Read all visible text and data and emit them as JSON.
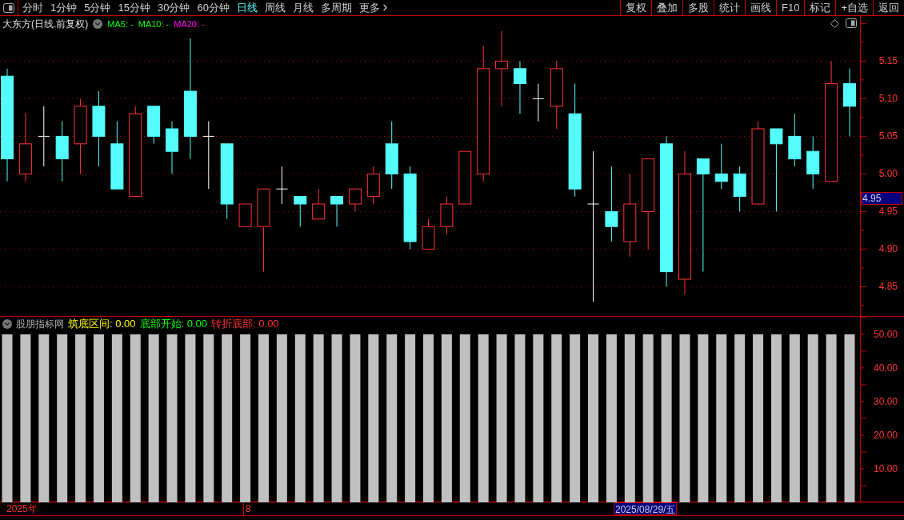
{
  "toolbar": {
    "periods": [
      {
        "label": "分时",
        "selected": false
      },
      {
        "label": "1分钟",
        "selected": false
      },
      {
        "label": "5分钟",
        "selected": false
      },
      {
        "label": "15分钟",
        "selected": false
      },
      {
        "label": "30分钟",
        "selected": false
      },
      {
        "label": "60分钟",
        "selected": false
      },
      {
        "label": "日线",
        "selected": true
      },
      {
        "label": "周线",
        "selected": false
      },
      {
        "label": "月线",
        "selected": false
      },
      {
        "label": "多周期",
        "selected": false
      }
    ],
    "more": "更多",
    "actions": [
      "复权",
      "叠加",
      "多股",
      "统计",
      "画线",
      "F10",
      "标记",
      "+自选",
      "返回"
    ]
  },
  "stock": {
    "title": "大东方(日线.前复权)",
    "indicators": [
      {
        "label": "MA5: -",
        "color": "#00ff00"
      },
      {
        "label": "MA10: -",
        "color": "#00ff00"
      },
      {
        "label": "MA20: -",
        "color": "#ff00ff"
      }
    ]
  },
  "price_chart": {
    "price_marker": "4.95",
    "chart_data": {
      "type": "candlestick",
      "ylim": [
        4.81,
        5.21
      ],
      "yticks": [
        {
          "value": 5.15,
          "label": "5.15"
        },
        {
          "value": 5.1,
          "label": "5.10"
        },
        {
          "value": 5.05,
          "label": "5.05"
        },
        {
          "value": 5.0,
          "label": "5.00"
        },
        {
          "value": 4.95,
          "label": "4.95"
        },
        {
          "value": 4.9,
          "label": "4.90"
        },
        {
          "value": 4.85,
          "label": "4.85"
        }
      ],
      "grid": true,
      "ohlc": [
        [
          5.13,
          5.14,
          4.99,
          5.02
        ],
        [
          5.0,
          5.08,
          4.99,
          5.04
        ],
        [
          5.05,
          5.09,
          5.01,
          5.05
        ],
        [
          5.05,
          5.07,
          4.99,
          5.02
        ],
        [
          5.04,
          5.1,
          5.0,
          5.09
        ],
        [
          5.09,
          5.11,
          5.01,
          5.05
        ],
        [
          5.04,
          5.07,
          4.98,
          4.98
        ],
        [
          4.97,
          5.09,
          4.97,
          5.08
        ],
        [
          5.09,
          5.09,
          5.04,
          5.05
        ],
        [
          5.06,
          5.07,
          5.0,
          5.03
        ],
        [
          5.11,
          5.18,
          5.02,
          5.05
        ],
        [
          5.05,
          5.07,
          4.98,
          5.05
        ],
        [
          5.04,
          5.04,
          4.94,
          4.96
        ],
        [
          4.93,
          4.96,
          4.93,
          4.96
        ],
        [
          4.93,
          4.98,
          4.87,
          4.98
        ],
        [
          4.98,
          5.01,
          4.96,
          4.98
        ],
        [
          4.97,
          4.97,
          4.93,
          4.96
        ],
        [
          4.94,
          4.98,
          4.94,
          4.96
        ],
        [
          4.97,
          4.97,
          4.93,
          4.96
        ],
        [
          4.96,
          4.98,
          4.95,
          4.98
        ],
        [
          4.97,
          5.01,
          4.96,
          5.0
        ],
        [
          5.04,
          5.07,
          4.98,
          5.0
        ],
        [
          5.0,
          5.01,
          4.9,
          4.91
        ],
        [
          4.9,
          4.94,
          4.9,
          4.93
        ],
        [
          4.93,
          4.97,
          4.92,
          4.96
        ],
        [
          4.96,
          5.03,
          4.96,
          5.03
        ],
        [
          5.0,
          5.17,
          4.99,
          5.14
        ],
        [
          5.14,
          5.19,
          5.09,
          5.15
        ],
        [
          5.14,
          5.15,
          5.08,
          5.12
        ],
        [
          5.1,
          5.12,
          5.07,
          5.1
        ],
        [
          5.09,
          5.15,
          5.06,
          5.14
        ],
        [
          5.08,
          5.12,
          4.97,
          4.98
        ],
        [
          4.96,
          5.03,
          4.83,
          4.96
        ],
        [
          4.95,
          5.01,
          4.91,
          4.93
        ],
        [
          4.91,
          5.0,
          4.89,
          4.96
        ],
        [
          4.95,
          5.02,
          4.9,
          5.02
        ],
        [
          5.04,
          5.05,
          4.85,
          4.87
        ],
        [
          4.86,
          5.03,
          4.84,
          5.0
        ],
        [
          5.02,
          5.02,
          4.87,
          5.0
        ],
        [
          5.0,
          5.04,
          4.98,
          4.99
        ],
        [
          5.0,
          5.01,
          4.95,
          4.97
        ],
        [
          4.96,
          5.07,
          4.96,
          5.06
        ],
        [
          5.06,
          5.06,
          4.95,
          5.04
        ],
        [
          5.05,
          5.08,
          5.01,
          5.02
        ],
        [
          5.03,
          5.05,
          4.98,
          5.0
        ],
        [
          4.99,
          5.15,
          4.99,
          5.12
        ],
        [
          5.12,
          5.14,
          5.05,
          5.09
        ]
      ]
    }
  },
  "indicator_pane": {
    "title": "股朋指标网",
    "readings": [
      {
        "label": "筑底区间: 0.00",
        "color": "#ffff00"
      },
      {
        "label": "底部开始: 0.00",
        "color": "#00ff00"
      },
      {
        "label": "转折底部: 0.00",
        "color": "#ff3232"
      }
    ],
    "chart_data": {
      "type": "bar",
      "ylim": [
        0,
        55.2
      ],
      "yticks": [
        {
          "value": 50,
          "label": "50.00"
        },
        {
          "value": 40,
          "label": "40.00"
        },
        {
          "value": 30,
          "label": "30.00"
        },
        {
          "value": 20,
          "label": "20.00"
        },
        {
          "value": 10,
          "label": "10.00"
        }
      ],
      "series": [
        {
          "color": "#c0c0c0",
          "values": [
            50,
            50,
            50,
            50,
            50,
            50,
            50,
            50,
            50,
            50,
            50,
            50,
            50,
            50,
            50,
            50,
            50,
            50,
            50,
            50,
            50,
            50,
            50,
            50,
            50,
            50,
            50,
            50,
            50,
            50,
            50,
            50,
            50,
            50,
            50,
            50,
            50,
            50,
            50,
            50,
            50,
            50,
            50,
            50,
            50,
            50,
            50
          ]
        }
      ]
    }
  },
  "date_bar": {
    "year": "2025年",
    "month": "8",
    "cursor_date": "2025/08/29/五"
  }
}
